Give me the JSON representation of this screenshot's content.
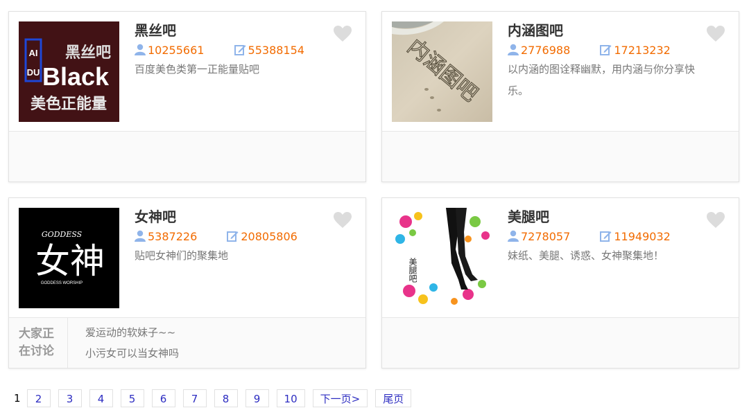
{
  "cards": [
    {
      "name": "黑丝吧",
      "members": "10255661",
      "posts": "55388154",
      "desc": "百度美色类第一正能量贴吧",
      "thumb": "black"
    },
    {
      "name": "内涵图吧",
      "members": "2776988",
      "posts": "17213232",
      "desc": "以内涵的图诠释幽默，用内涵与你分享快乐。",
      "thumb": "sand"
    },
    {
      "name": "女神吧",
      "members": "5387226",
      "posts": "20805806",
      "desc": "贴吧女神们的聚集地",
      "thumb": "goddess",
      "discuss_label": "大家正在讨论",
      "topics": [
        "爱运动的软妹子~~",
        "小污女可以当女神吗"
      ]
    },
    {
      "name": "美腿吧",
      "members": "7278057",
      "posts": "11949032",
      "desc": "妹纸、美腿、诱惑、女神聚集地！",
      "thumb": "legs"
    }
  ],
  "thumb_text": {
    "black_aidu_top": "AI",
    "black_aidu_bottom": "DU",
    "black_cn": "黑丝吧",
    "black_word": "Black",
    "black_slogan": "美色正能量",
    "sand_text": "内涵图吧",
    "goddess_en": "GODDESS",
    "goddess_cn": "女神",
    "goddess_small": "GODDESS WORSHIP",
    "legs_text": "美腿吧"
  },
  "icons": {
    "members": "user-icon",
    "posts": "edit-icon",
    "like": "heart-icon"
  },
  "colors": {
    "count": "#f26b00",
    "link": "#2d2dc1",
    "user_icon": "#8fb4ea"
  },
  "pager": {
    "current": "1",
    "pages": [
      "2",
      "3",
      "4",
      "5",
      "6",
      "7",
      "8",
      "9",
      "10"
    ],
    "next": "下一页>",
    "last": "尾页"
  }
}
